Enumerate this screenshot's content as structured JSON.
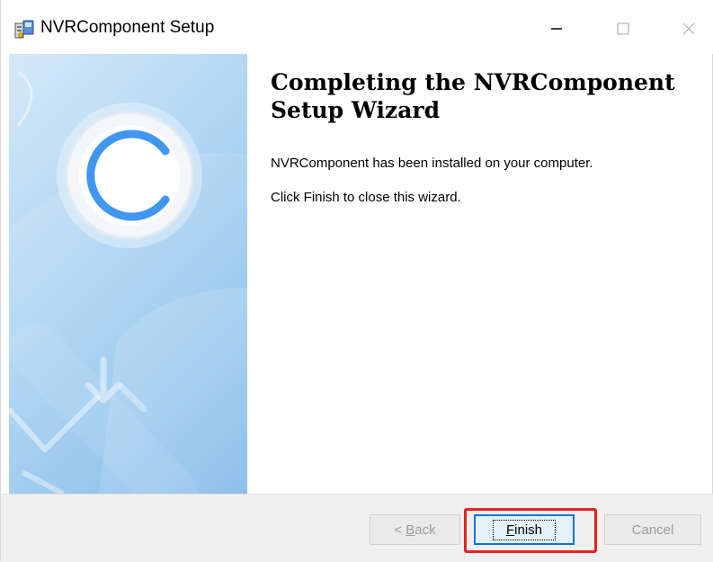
{
  "window": {
    "title": "NVRComponent Setup"
  },
  "content": {
    "heading": "Completing the NVRComponent Setup Wizard",
    "line1": "NVRComponent has been installed on your computer.",
    "line2": "Click Finish to close this wizard."
  },
  "buttons": {
    "back": {
      "accel": "<",
      "rest_prefix": " ",
      "underlined": "B",
      "rest": "ack",
      "label": "< Back",
      "enabled": false
    },
    "finish": {
      "underlined": "F",
      "rest": "inish",
      "label": "Finish",
      "enabled": true
    },
    "cancel": {
      "label": "Cancel",
      "enabled": false
    }
  },
  "colors": {
    "accent": "#0078d7",
    "highlight": "#e8201f",
    "side_panel": "#8ec2ec"
  },
  "icons": [
    "installer-icon",
    "minimize-icon",
    "maximize-icon",
    "close-icon",
    "installer-logo-icon"
  ]
}
